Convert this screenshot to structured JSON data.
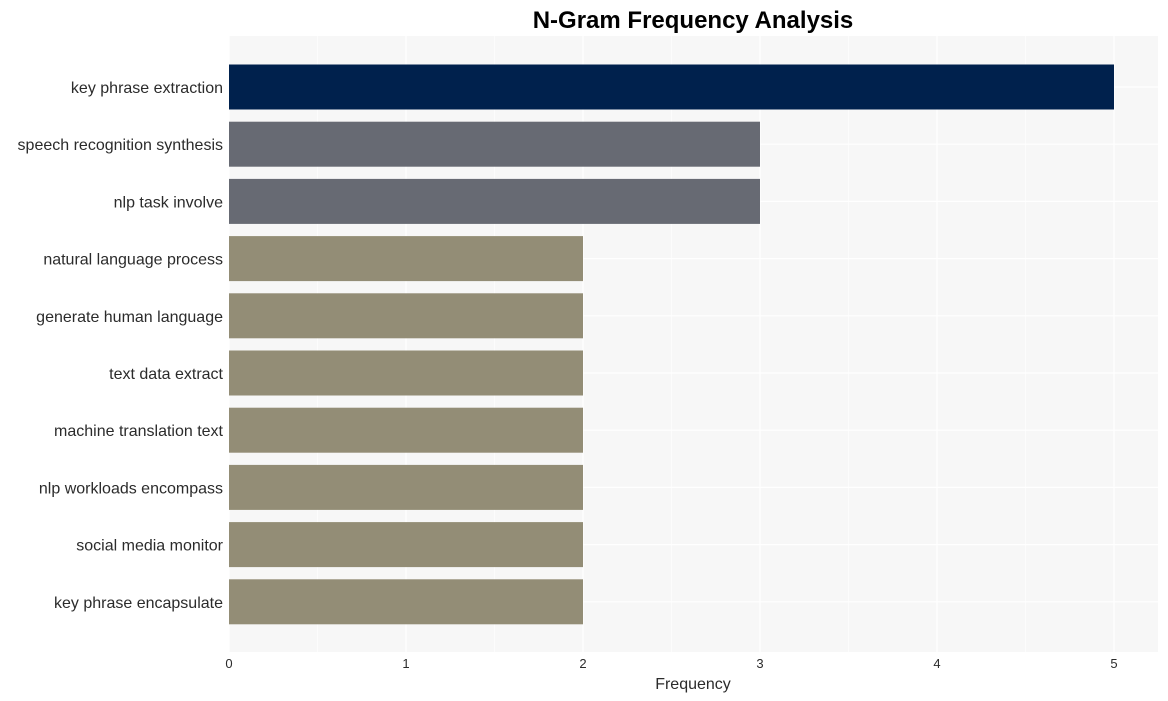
{
  "chart_data": {
    "type": "bar",
    "orientation": "horizontal",
    "title": "N-Gram Frequency Analysis",
    "xlabel": "Frequency",
    "ylabel": "",
    "categories": [
      "key phrase extraction",
      "speech recognition synthesis",
      "nlp task involve",
      "natural language process",
      "generate human language",
      "text data extract",
      "machine translation text",
      "nlp workloads encompass",
      "social media monitor",
      "key phrase encapsulate"
    ],
    "values": [
      5,
      3,
      3,
      2,
      2,
      2,
      2,
      2,
      2,
      2
    ],
    "colors": [
      "#00214d",
      "#676a73",
      "#676a73",
      "#938d76",
      "#938d76",
      "#938d76",
      "#938d76",
      "#938d76",
      "#938d76",
      "#938d76"
    ],
    "xlim": [
      0,
      5.25
    ],
    "xticks": [
      0,
      1,
      2,
      3,
      4,
      5
    ],
    "grid": true,
    "legend": "none",
    "background": "#f7f7f7"
  }
}
